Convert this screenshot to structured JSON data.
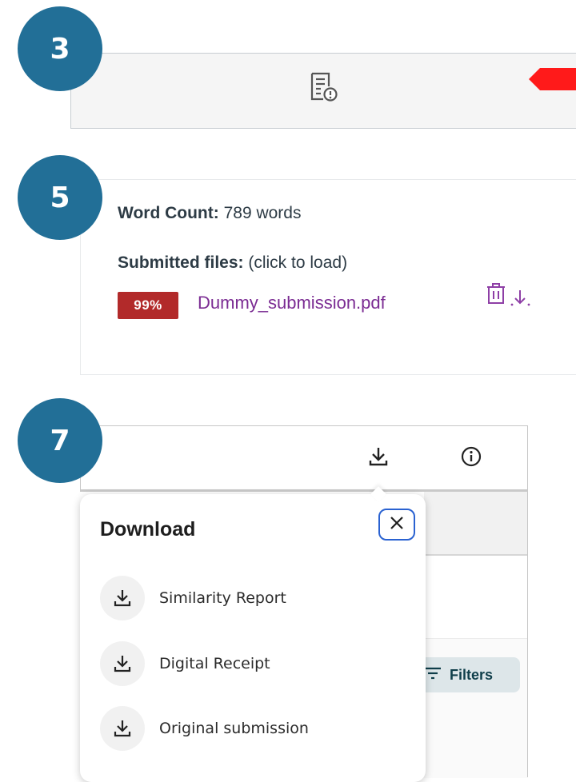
{
  "badges": [
    "3",
    "5",
    "7"
  ],
  "submission": {
    "word_count_label": "Word Count:",
    "word_count_value": "789 words",
    "files_label": "Submitted files:",
    "files_hint": "(click to load)",
    "similarity_score": "99%",
    "file_name": "Dummy_submission.pdf"
  },
  "download_menu": {
    "title": "Download",
    "items": [
      {
        "label": "Similarity Report",
        "icon": "download-icon"
      },
      {
        "label": "Digital Receipt",
        "icon": "download-icon"
      },
      {
        "label": "Original submission",
        "icon": "download-icon"
      }
    ]
  },
  "toolbar": {
    "filters_label": "Filters"
  },
  "colors": {
    "badge": "#226f97",
    "score_badge": "#b22a2a",
    "link": "#7b2c93",
    "flag": "#ff1a1a",
    "focus_ring": "#2a62d1"
  }
}
